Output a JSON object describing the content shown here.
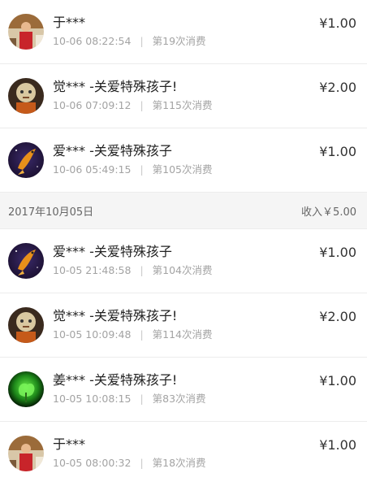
{
  "records_top": [
    {
      "name": "于***",
      "time": "10-06 08:22:54",
      "count": "第19次消费",
      "amount": "¥1.00",
      "avatar": "avatar-photo-red"
    },
    {
      "name": "觉*** -关爱特殊孩子!",
      "time": "10-06 07:09:12",
      "count": "第115次消费",
      "amount": "¥2.00",
      "avatar": "avatar-monk"
    },
    {
      "name": "爱*** -关爱特殊孩子",
      "time": "10-06 05:49:15",
      "count": "第105次消费",
      "amount": "¥1.00",
      "avatar": "avatar-koi"
    }
  ],
  "date_header": {
    "date": "2017年10月05日",
    "income": "收入￥5.00"
  },
  "records_bottom": [
    {
      "name": "爱*** -关爱特殊孩子",
      "time": "10-05 21:48:58",
      "count": "第104次消费",
      "amount": "¥1.00",
      "avatar": "avatar-koi"
    },
    {
      "name": "觉*** -关爱特殊孩子!",
      "time": "10-05 10:09:48",
      "count": "第114次消费",
      "amount": "¥2.00",
      "avatar": "avatar-monk"
    },
    {
      "name": "姜*** -关爱特殊孩子!",
      "time": "10-05 10:08:15",
      "count": "第83次消费",
      "amount": "¥1.00",
      "avatar": "avatar-green-plant"
    },
    {
      "name": "于***",
      "time": "10-05 08:00:32",
      "count": "第18次消费",
      "amount": "¥1.00",
      "avatar": "avatar-photo-red"
    }
  ],
  "separator": "|"
}
